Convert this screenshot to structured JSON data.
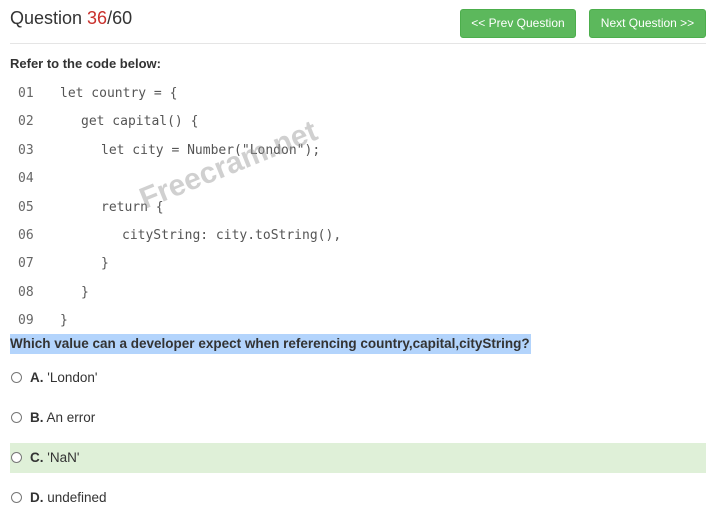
{
  "header": {
    "question_label": "Question ",
    "question_number": "36",
    "question_total": "/60",
    "prev_label": "<< Prev Question",
    "next_label": "Next Question >>"
  },
  "prompt": "Refer to the code below:",
  "code_lines": [
    {
      "num": "01",
      "text": "let country = {"
    },
    {
      "num": "02",
      "text": "get capital() {"
    },
    {
      "num": "03",
      "text": "let city = Number(\"London\");"
    },
    {
      "num": "04",
      "text": ""
    },
    {
      "num": "05",
      "text": "return {"
    },
    {
      "num": "06",
      "text": "cityString: city.toString(),"
    },
    {
      "num": "07",
      "text": "}"
    },
    {
      "num": "08",
      "text": "}"
    },
    {
      "num": "09",
      "text": "}"
    }
  ],
  "watermark": "Freecram.net",
  "question": "Which value can a developer expect when referencing country,capital,cityString?",
  "options": [
    {
      "letter": "A.",
      "text": " 'London'"
    },
    {
      "letter": "B.",
      "text": " An error"
    },
    {
      "letter": "C.",
      "text": " 'NaN'"
    },
    {
      "letter": "D.",
      "text": " undefined"
    }
  ],
  "colors": {
    "button_green": "#5cb85c",
    "question_number_red": "#c9302c",
    "question_highlight": "#b3d4fc",
    "correct_option_bg": "#dff0d8"
  }
}
